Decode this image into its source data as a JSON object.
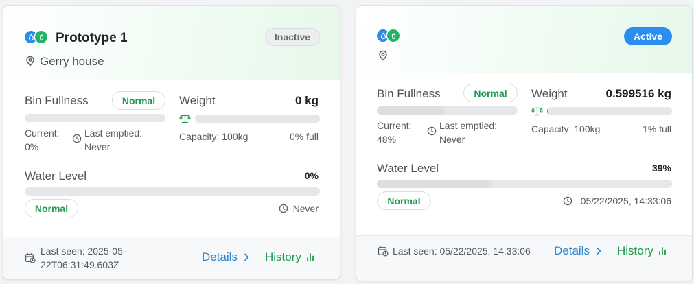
{
  "cards": [
    {
      "title": "Prototype 1",
      "location": "Gerry house",
      "status": "Inactive",
      "bin": {
        "label": "Bin Fullness",
        "state": "Normal",
        "fill_fraction": 0,
        "current_label": "Current:",
        "current_value": "0%",
        "emptied_label": "Last emptied:",
        "emptied_value": "Never"
      },
      "weight": {
        "label": "Weight",
        "value": "0 kg",
        "fill_fraction": 0,
        "capacity": "Capacity: 100kg",
        "percent_full": "0% full"
      },
      "water": {
        "label": "Water Level",
        "value": "0%",
        "fill_fraction": 0,
        "state": "Normal",
        "updated": "Never"
      },
      "footer": {
        "last_seen_line1": "Last seen: 2025-05-",
        "last_seen_line2": "22T06:31:49.603Z",
        "details": "Details",
        "history": "History"
      }
    },
    {
      "title": "",
      "location": "",
      "status": "Active",
      "bin": {
        "label": "Bin Fullness",
        "state": "Normal",
        "fill_fraction": 0.48,
        "current_label": "Current:",
        "current_value": "48%",
        "emptied_label": "Last emptied:",
        "emptied_value": "Never"
      },
      "weight": {
        "label": "Weight",
        "value": "0.599516 kg",
        "fill_fraction": 0.01,
        "capacity": "Capacity: 100kg",
        "percent_full": "1% full"
      },
      "water": {
        "label": "Water Level",
        "value": "39%",
        "fill_fraction": 0.39,
        "state": "Normal",
        "updated": "05/22/2025, 14:33:06"
      },
      "footer": {
        "last_seen": "Last seen: 05/22/2025, 14:33:06",
        "details": "Details",
        "history": "History"
      }
    }
  ],
  "icons": {
    "water_type": "droplet-icon",
    "waste_type": "trash-icon",
    "location": "map-pin-icon",
    "clock": "clock-icon",
    "scale": "scale-icon",
    "calendar": "calendar-clock-icon",
    "details_arrow": "chevron-right-icon",
    "history": "bar-chart-icon"
  },
  "colors": {
    "active_badge": "#2a8ef0",
    "normal_text": "#1e9a4f",
    "details_link": "#2b86d8",
    "history_link": "#1e9a4f",
    "water_icon": "#2b8de3",
    "waste_icon": "#22b364"
  }
}
